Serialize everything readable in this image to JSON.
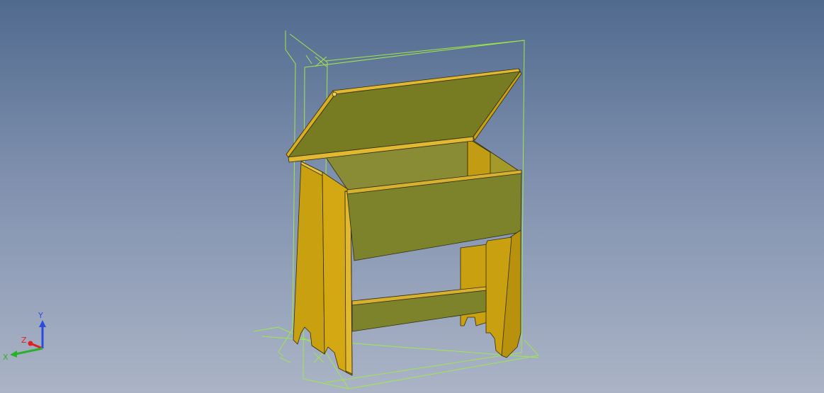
{
  "viewport": {
    "background_top": "#506a8e",
    "background_bottom": "#abb4c6"
  },
  "model": {
    "name": "",
    "wood_colors": {
      "front_face": "#7c832b",
      "lid_face": "#777b22",
      "side_face": "#c9a010",
      "edge_highlight": "#e2b830",
      "outline": "#2f2c0c"
    },
    "bounding_box_color": "#9ee84a"
  },
  "triad": {
    "x_label": "X",
    "y_label": "Y",
    "z_label": "Z",
    "x_color": "#2ab12a",
    "y_color": "#2a4bdc",
    "z_color": "#e02020"
  }
}
